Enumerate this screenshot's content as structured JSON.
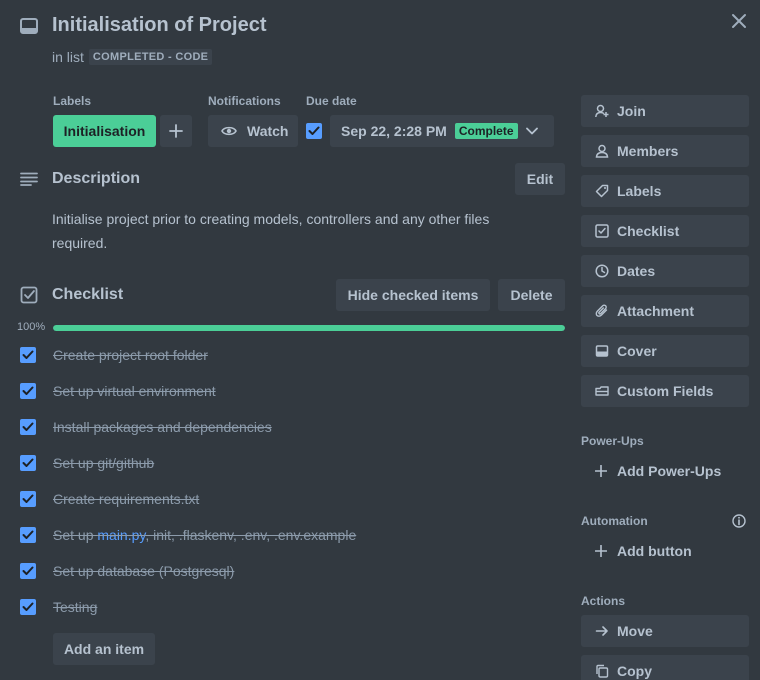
{
  "header": {
    "title": "Initialisation of Project",
    "in_list_prefix": "in list",
    "list_name": "COMPLETED - CODE",
    "close_icon": "close-icon",
    "card_icon": "card-icon"
  },
  "meta": {
    "labels_heading": "Labels",
    "label_name": "Initialisation",
    "notifications_heading": "Notifications",
    "watch_label": "Watch",
    "due_heading": "Due date",
    "due_value": "Sep 22, 2:28 PM",
    "due_status": "Complete",
    "colors": {
      "label_green": "#4bce97",
      "checkbox_blue": "#579dff",
      "background": "#323940"
    }
  },
  "description": {
    "title": "Description",
    "edit_label": "Edit",
    "text": "Initialise project prior to creating models, controllers and any other files required."
  },
  "checklist": {
    "title": "Checklist",
    "hide_label": "Hide checked items",
    "delete_label": "Delete",
    "percent_label": "100%",
    "progress": 1.0,
    "items": [
      {
        "text": "Create project root folder",
        "checked": true
      },
      {
        "text": "Set up virtual environment",
        "checked": true
      },
      {
        "text": "Install packages and dependencies",
        "checked": true
      },
      {
        "text": "Set up git/github",
        "checked": true
      },
      {
        "text": "Create requirements.txt",
        "checked": true
      },
      {
        "text_before": "Set up ",
        "link": "main.py",
        "text_after": ", init, .flaskenv, .env, .env.example",
        "checked": true
      },
      {
        "text": "Set up database (Postgresql)",
        "checked": true
      },
      {
        "text": "Testing",
        "checked": true
      }
    ],
    "add_item_label": "Add an item"
  },
  "sidebar": {
    "buttons": [
      {
        "label": "Join",
        "icon": "add-user-icon"
      },
      {
        "label": "Members",
        "icon": "user-icon"
      },
      {
        "label": "Labels",
        "icon": "tag-icon"
      },
      {
        "label": "Checklist",
        "icon": "checklist-icon"
      },
      {
        "label": "Dates",
        "icon": "clock-icon"
      },
      {
        "label": "Attachment",
        "icon": "paperclip-icon"
      },
      {
        "label": "Cover",
        "icon": "cover-icon"
      },
      {
        "label": "Custom Fields",
        "icon": "custom-fields-icon"
      }
    ],
    "powerups_heading": "Power-Ups",
    "add_powerups_label": "Add Power-Ups",
    "automation_heading": "Automation",
    "add_button_label": "Add button",
    "actions_heading": "Actions",
    "actions": [
      {
        "label": "Move",
        "icon": "arrow-right-icon"
      },
      {
        "label": "Copy",
        "icon": "copy-icon"
      }
    ]
  }
}
